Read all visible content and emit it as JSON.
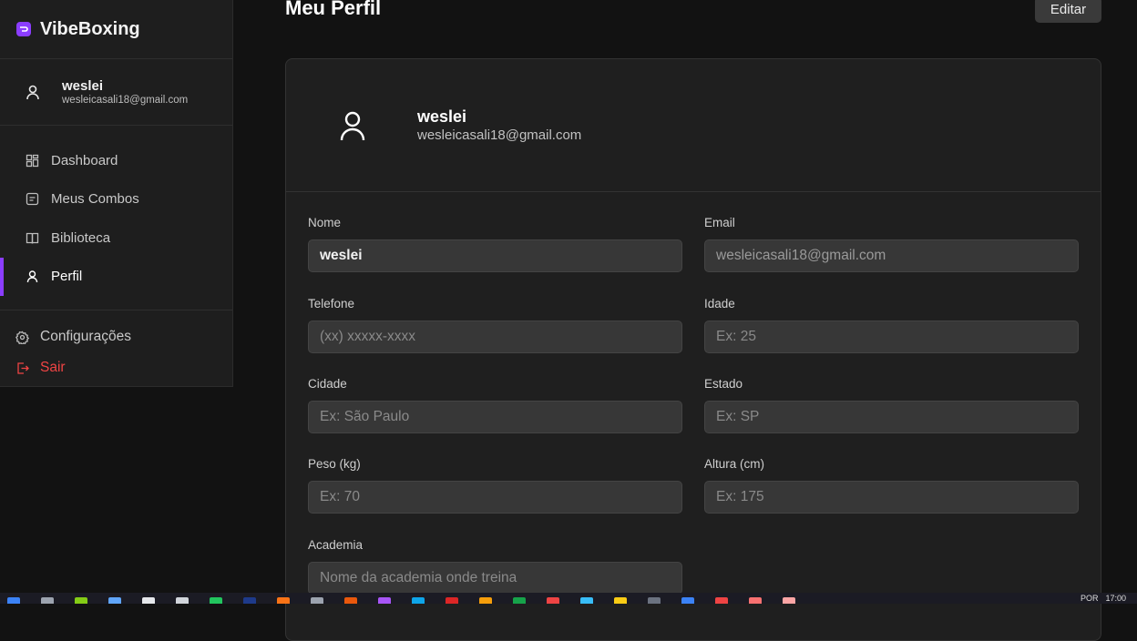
{
  "app": {
    "brand": "VibeBoxing",
    "brand_color": "#8b3dff"
  },
  "sidebar": {
    "user": {
      "name": "weslei",
      "email": "wesleicasali18@gmail.com"
    },
    "items": [
      {
        "label": "Dashboard",
        "icon": "dashboard-icon",
        "active": false
      },
      {
        "label": "Meus Combos",
        "icon": "combos-icon",
        "active": false
      },
      {
        "label": "Biblioteca",
        "icon": "book-icon",
        "active": false
      },
      {
        "label": "Perfil",
        "icon": "user-icon",
        "active": true
      }
    ],
    "settings_label": "Configurações",
    "logout_label": "Sair",
    "logout_color": "#ef4444"
  },
  "page": {
    "title": "Meu Perfil",
    "edit_label": "Editar"
  },
  "profile": {
    "name": "weslei",
    "email": "wesleicasali18@gmail.com"
  },
  "form": {
    "nome": {
      "label": "Nome",
      "value": "weslei"
    },
    "email": {
      "label": "Email",
      "value": "wesleicasali18@gmail.com"
    },
    "telefone": {
      "label": "Telefone",
      "placeholder": "(xx) xxxxx-xxxx"
    },
    "idade": {
      "label": "Idade",
      "placeholder": "Ex: 25"
    },
    "cidade": {
      "label": "Cidade",
      "placeholder": "Ex: São Paulo"
    },
    "estado": {
      "label": "Estado",
      "placeholder": "Ex: SP"
    },
    "peso": {
      "label": "Peso (kg)",
      "placeholder": "Ex: 70"
    },
    "altura": {
      "label": "Altura (cm)",
      "placeholder": "Ex: 175"
    },
    "academia": {
      "label": "Academia",
      "placeholder": "Nome da academia onde treina"
    }
  },
  "taskbar": {
    "lang": "POR",
    "time": "17:00"
  }
}
